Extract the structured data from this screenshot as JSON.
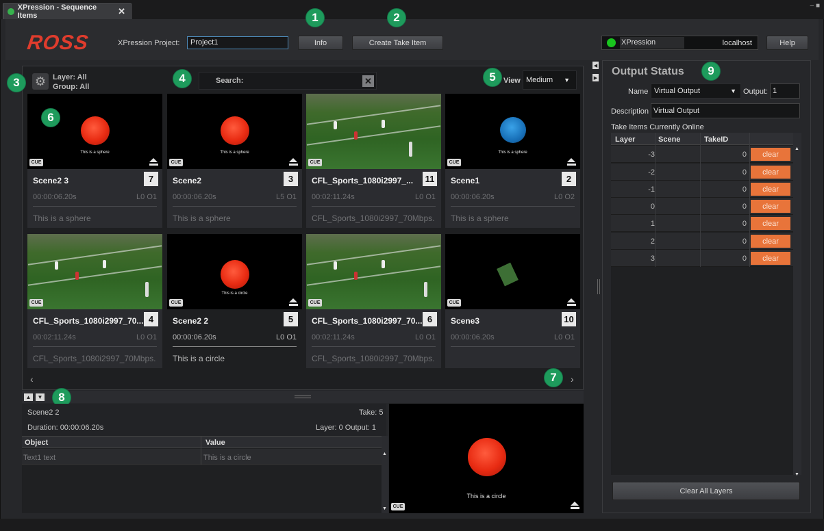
{
  "window": {
    "tab_title": "XPression - Sequence Items",
    "tab_close": "✕",
    "controls": "– ■"
  },
  "header": {
    "logo": "ROSS",
    "project_label": "XPression Project:",
    "project_value": "Project1",
    "info_label": "Info",
    "create_take_item_label": "Create Take Item",
    "xpression_label": "XPression",
    "xpression_host": "localhost",
    "status_color": "#19c51e",
    "help_label": "Help"
  },
  "badges": {
    "b1": "1",
    "b2": "2",
    "b3": "3",
    "b4": "4",
    "b5": "5",
    "b6": "6",
    "b7": "7",
    "b8": "8",
    "b9": "9"
  },
  "filter": {
    "layer": "Layer: All",
    "group": "Group: All",
    "search_label": "Search:",
    "search_clear": "✕",
    "view_label": "View",
    "view_value": "Medium"
  },
  "cards": [
    {
      "name": "Scene2 3",
      "num": "7",
      "time": "00:00:06.20s",
      "layer": "L0   O1",
      "desc": "This is a sphere",
      "cue": "CUE",
      "thumb_text": "This is a sphere"
    },
    {
      "name": "Scene2",
      "num": "3",
      "time": "00:00:06.20s",
      "layer": "L5   O1",
      "desc": "This is a sphere",
      "cue": "CUE",
      "thumb_text": "This is a sphere"
    },
    {
      "name": "CFL_Sports_1080i2997_...",
      "num": "11",
      "time": "00:02:11.24s",
      "layer": "L0   O1",
      "desc": "CFL_Sports_1080i2997_70Mbps...",
      "cue": "CUE",
      "thumb_text": ""
    },
    {
      "name": "Scene1",
      "num": "2",
      "time": "00:00:06.20s",
      "layer": "L0   O2",
      "desc": "This is a sphere",
      "cue": "CUE",
      "thumb_text": "This is a sphere"
    },
    {
      "name": "CFL_Sports_1080i2997_70...",
      "num": "4",
      "time": "00:02:11.24s",
      "layer": "L0   O1",
      "desc": "CFL_Sports_1080i2997_70Mbps...",
      "cue": "CUE",
      "thumb_text": ""
    },
    {
      "name": "Scene2 2",
      "num": "5",
      "time": "00:00:06.20s",
      "layer": "L0   O1",
      "desc": "This is a circle",
      "cue": "CUE",
      "thumb_text": "This is a circle"
    },
    {
      "name": "CFL_Sports_1080i2997_70...",
      "num": "6",
      "time": "00:02:11.24s",
      "layer": "L0   O1",
      "desc": "CFL_Sports_1080i2997_70Mbps...",
      "cue": "CUE",
      "thumb_text": ""
    },
    {
      "name": "Scene3",
      "num": "10",
      "time": "00:00:06.20s",
      "layer": "L0   O1",
      "desc": "",
      "cue": "CUE",
      "thumb_text": ""
    }
  ],
  "pager": {
    "prev": "‹",
    "next": "›"
  },
  "detail": {
    "scene": "Scene2 2",
    "take": "Take: 5",
    "duration": "Duration: 00:00:06.20s",
    "layer_output": "Layer: 0   Output: 1",
    "col_object": "Object",
    "col_value": "Value",
    "rows": [
      {
        "object": "Text1 text",
        "value": "This is a circle"
      }
    ],
    "preview_text": "This is a circle",
    "preview_cue": "CUE"
  },
  "output_status": {
    "title": "Output Status",
    "name_label": "Name",
    "name_value": "Virtual Output",
    "output_label": "Output:",
    "output_value": "1",
    "desc_label": "Description",
    "desc_value": "Virtual Output",
    "online_label": "Take Items Currently Online",
    "columns": [
      "Layer",
      "Scene",
      "TakeID"
    ],
    "rows": [
      {
        "layer": "-3",
        "scene": "",
        "takeid": "0",
        "action": "clear"
      },
      {
        "layer": "-2",
        "scene": "",
        "takeid": "0",
        "action": "clear"
      },
      {
        "layer": "-1",
        "scene": "",
        "takeid": "0",
        "action": "clear"
      },
      {
        "layer": "0",
        "scene": "",
        "takeid": "0",
        "action": "clear"
      },
      {
        "layer": "1",
        "scene": "",
        "takeid": "0",
        "action": "clear"
      },
      {
        "layer": "2",
        "scene": "",
        "takeid": "0",
        "action": "clear"
      },
      {
        "layer": "3",
        "scene": "",
        "takeid": "0",
        "action": "clear"
      }
    ],
    "clear_all_label": "Clear All Layers",
    "clear_color": "#e8743a"
  },
  "icons": {
    "gear": "⚙",
    "chevron_down": "▼",
    "up": "▲",
    "down": "▼",
    "left": "◀",
    "right": "▶"
  }
}
